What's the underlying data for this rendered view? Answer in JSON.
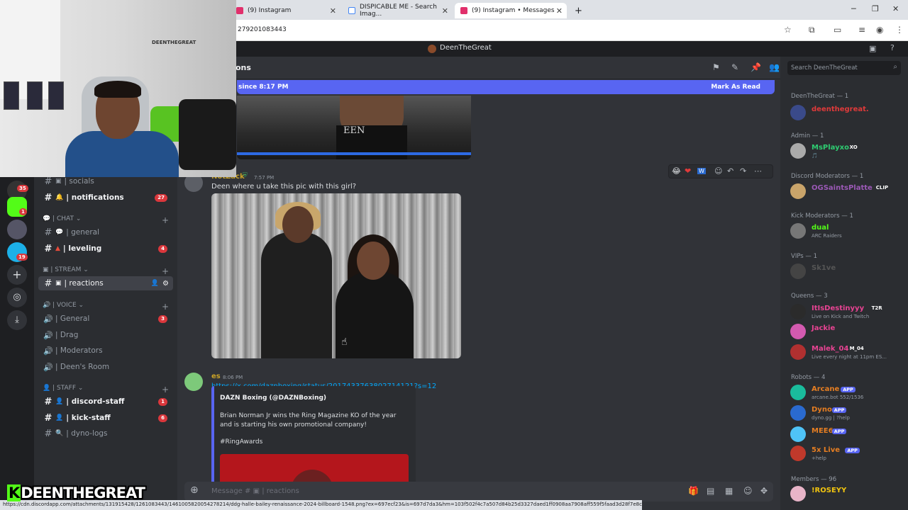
{
  "browser": {
    "tabs": [
      {
        "label": "(9) Instagram",
        "color": "#e1306c"
      },
      {
        "label": "DISPICABLE ME - Search Imag...",
        "color": "#4285f4"
      },
      {
        "label": "(9) Instagram • Messages",
        "color": "#e1306c"
      }
    ],
    "new_tab": "+",
    "url": "279201083443",
    "status_url": "https://cdn.discordapp.com/attachments/131915428/1261083443/1461005820054278214/ddg-halle-bailey-renaissance-2024-billboard-1548.png?ex=697ecf23&is=697d7da3&hm=103f502f4c7a507d84b25d3327daed1ff0908aa7908aff559f5faad3d28f7e8c&"
  },
  "app": {
    "title": "DeenTheGreat"
  },
  "servers": {
    "badges": [
      "35",
      "1",
      "19"
    ]
  },
  "channels": {
    "top": [
      {
        "label": "socials",
        "emoji": "▣"
      },
      {
        "label": "notifications",
        "emoji": "🔔",
        "count": "27"
      }
    ],
    "chat_cat": "| CHAT",
    "chat": [
      {
        "label": "general",
        "emoji": "💬"
      },
      {
        "label": "leveling",
        "emoji": "▲",
        "count": "4"
      }
    ],
    "stream_cat": "| STREAM",
    "stream": [
      {
        "label": "reactions",
        "emoji": "▣"
      }
    ],
    "voice_cat": "| VOICE",
    "voice": [
      {
        "label": "General",
        "count": "3"
      },
      {
        "label": "Drag"
      },
      {
        "label": "Moderators"
      },
      {
        "label": "Deen's Room"
      }
    ],
    "staff_cat": "| STAFF",
    "staff": [
      {
        "label": "discord-staff",
        "count": "1"
      },
      {
        "label": "kick-staff",
        "count": "6"
      },
      {
        "label": "dyno-logs"
      }
    ]
  },
  "main": {
    "channel_name": "ons",
    "new_messages": "since 8:17 PM",
    "mark_read": "Mark As Read",
    "image1_text": "EEN",
    "msg1": {
      "user": "NotZack",
      "time": "7:57 PM",
      "text": "Deen where u take this pic with this girl?"
    },
    "msg2": {
      "user": "es",
      "time": "8:06 PM",
      "link": "https://x.com/daznboxing/status/2017433763802714121?s=12",
      "embed_author": "DAZN Boxing (@DAZNBoxing)",
      "embed_desc": "Brian Norman Jr wins the Ring Magazine KO of the year and is starting his own promotional company!",
      "embed_hashtag": "#RingAwards"
    },
    "input_placeholder": "Message # ▣ | reactions"
  },
  "members": {
    "search_placeholder": "Search DeenTheGreat",
    "groups": [
      {
        "role": "DeenTheGreat — 1",
        "list": [
          {
            "name": "deenthegreat.",
            "color": "#e03a3a",
            "avatar": "#3a4a8a"
          }
        ]
      },
      {
        "role": "Admin — 1",
        "list": [
          {
            "name": "MsPlayxo",
            "color": "#2ecc71",
            "sub": "🎵",
            "tag": "XO",
            "avatar": "#aaa"
          }
        ]
      },
      {
        "role": "Discord Moderators — 1",
        "list": [
          {
            "name": "OGSaintsPlatte",
            "color": "#9b59b6",
            "tag": "CLIP",
            "avatar": "#c9a46a"
          }
        ]
      },
      {
        "role": "Kick Moderators — 1",
        "list": [
          {
            "name": "dual",
            "color": "#53fc18",
            "sub": "ARC Raiders",
            "avatar": "#777"
          }
        ]
      },
      {
        "role": "VIPs — 1",
        "list": [
          {
            "name": "Sk1ve",
            "color": "#555",
            "avatar": "#444"
          }
        ]
      },
      {
        "role": "Queens — 3",
        "list": [
          {
            "name": "ItIsDestinyyy",
            "color": "#e84393",
            "sub": "Live on Kick and Twitch",
            "tag": "T2R",
            "avatar": "#2b2b2b"
          },
          {
            "name": "Jackie",
            "color": "#e84393",
            "avatar": "#d35ab0"
          },
          {
            "name": "Malek_04",
            "color": "#e84393",
            "sub": "Live every night at 11pm ES...",
            "tag": "M_04",
            "avatar": "#b03030"
          }
        ]
      },
      {
        "role": "Robots — 4",
        "list": [
          {
            "name": "Arcane",
            "color": "#e67e22",
            "sub": "arcane.bot 552/1536",
            "app": "APP",
            "avatar": "#1abc9c"
          },
          {
            "name": "Dyno",
            "color": "#e67e22",
            "sub": "dyno.gg | ?help",
            "app": "APP",
            "avatar": "#2a6acf"
          },
          {
            "name": "MEE6",
            "color": "#e67e22",
            "app": "APP",
            "avatar": "#4fc3f7"
          },
          {
            "name": "5x Live",
            "color": "#e67e22",
            "sub": "+help",
            "app": "APP",
            "avatar": "#c0392b"
          }
        ]
      },
      {
        "role": "Members — 96",
        "list": [
          {
            "name": "!ROSEYY",
            "color": "#f1c40f",
            "avatar": "#e8b4c8"
          }
        ]
      }
    ]
  },
  "webcam": {
    "logo_text": "DEENTHEGREAT"
  },
  "brand": {
    "k": "K",
    "rest": "DEENTHEGREAT"
  }
}
